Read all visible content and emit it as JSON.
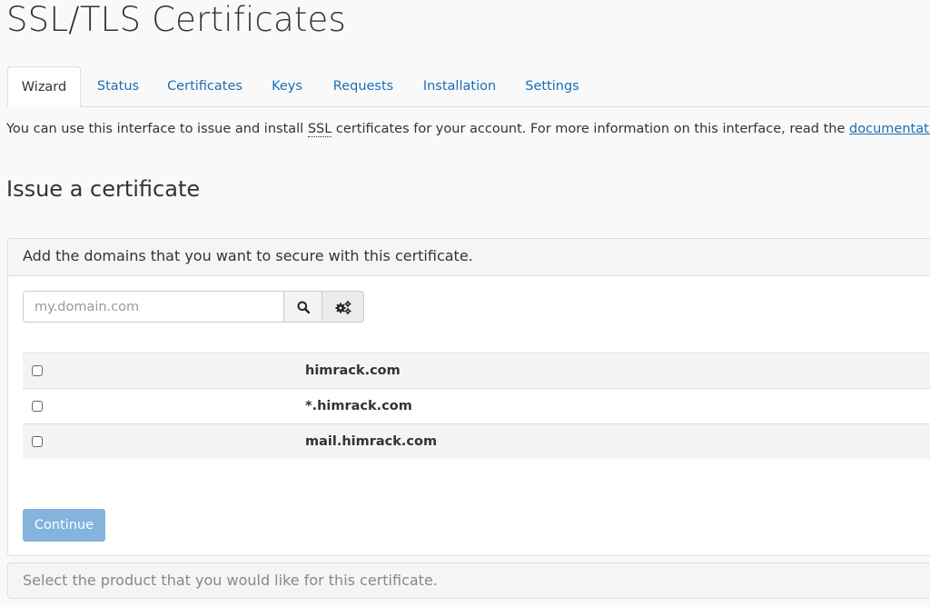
{
  "page": {
    "title": "SSL/TLS Certificates"
  },
  "tabs": [
    {
      "label": "Wizard",
      "active": true
    },
    {
      "label": "Status"
    },
    {
      "label": "Certificates"
    },
    {
      "label": "Keys"
    },
    {
      "label": "Requests"
    },
    {
      "label": "Installation"
    },
    {
      "label": "Settings"
    }
  ],
  "intro": {
    "text_before": "You can use this interface to issue and install ",
    "abbr": "SSL",
    "text_middle": " certificates for your account. For more information on this interface, read the ",
    "link": "documentation",
    "text_after": "."
  },
  "issue": {
    "heading": "Issue a certificate",
    "panel_title": "Add the domains that you want to secure with this certificate.",
    "search_placeholder": "my.domain.com",
    "search_icon": "search-icon",
    "options_icon": "gears-icon",
    "domains": [
      {
        "name": "himrack.com",
        "checked": false
      },
      {
        "name": "*.himrack.com",
        "checked": false
      },
      {
        "name": "mail.himrack.com",
        "checked": false
      }
    ],
    "continue_label": "Continue",
    "continue_color": "#84b3de"
  },
  "product_panel": {
    "title": "Select the product that you would like for this certificate."
  },
  "colors": {
    "link": "#1a6fb5",
    "text": "#333333",
    "border": "#dddddd"
  }
}
